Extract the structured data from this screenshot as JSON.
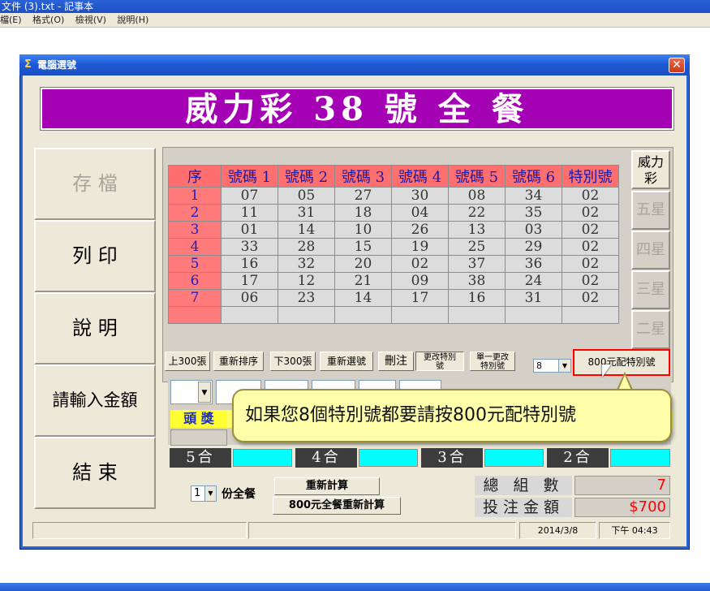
{
  "notepad": {
    "title": "文件 (3).txt - 記事本",
    "menu": [
      "檔(E)",
      "格式(O)",
      "檢視(V)",
      "說明(H)"
    ]
  },
  "window": {
    "title": "電腦選號",
    "close": "✕"
  },
  "banner": "威力彩 38 號 全 餐",
  "nav": {
    "save": "存 檔",
    "print": "列 印",
    "help": "說 明",
    "amount": "請輸入金額",
    "exit": "結 束"
  },
  "grid": {
    "headers": [
      "序",
      "號碼 1",
      "號碼 2",
      "號碼 3",
      "號碼 4",
      "號碼 5",
      "號碼 6",
      "特別號"
    ],
    "rows": [
      [
        "1",
        "07",
        "05",
        "27",
        "30",
        "08",
        "34",
        "02"
      ],
      [
        "2",
        "11",
        "31",
        "18",
        "04",
        "22",
        "35",
        "02"
      ],
      [
        "3",
        "01",
        "14",
        "10",
        "26",
        "13",
        "03",
        "02"
      ],
      [
        "4",
        "33",
        "28",
        "15",
        "19",
        "25",
        "29",
        "02"
      ],
      [
        "5",
        "16",
        "32",
        "20",
        "02",
        "37",
        "36",
        "02"
      ],
      [
        "6",
        "17",
        "12",
        "21",
        "09",
        "38",
        "24",
        "02"
      ],
      [
        "7",
        "06",
        "23",
        "14",
        "17",
        "16",
        "31",
        "02"
      ]
    ]
  },
  "tabs": [
    "威力彩",
    "五星",
    "四星",
    "三星",
    "二星"
  ],
  "toolbar": {
    "prev300": "上300張",
    "resort": "重新排序",
    "next300": "下300張",
    "reselect": "重新選號",
    "delete": "刪注",
    "change_special_1": "更改特別",
    "change_special_2": "號",
    "single_change_1": "單一更改",
    "single_change_2": "特別號",
    "special_count": "8",
    "special800": "800元配特別號"
  },
  "prizes": {
    "head": "頭 獎",
    "c5": "5合",
    "c4": "4合",
    "c3": "3合",
    "c2": "2合"
  },
  "callout": "如果您8個特別號都要請按800元配特別號",
  "bottom": {
    "copies": "1",
    "copies_label": "份全餐",
    "recalc": "重新計算",
    "recalc800": "800元全餐重新計算",
    "total_label": "總 組 數",
    "total_value": "7",
    "bet_label": "投注金額",
    "bet_value": "$700"
  },
  "status": {
    "date": "2014/3/8",
    "time": "下午 04:43"
  }
}
